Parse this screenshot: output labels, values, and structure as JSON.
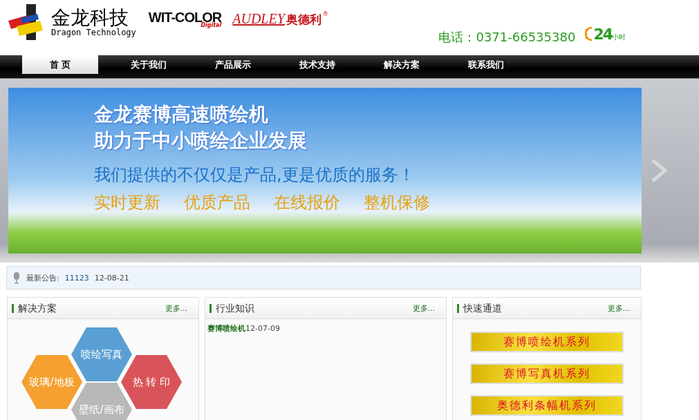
{
  "header": {
    "logo_name": "金龙科技",
    "logo_subtitle": "Dragon Technology",
    "brand_1": "WIT-COLOR",
    "brand_1_sub": "Digital",
    "brand_2": "AUDLEY",
    "brand_2_cn": "奥德利",
    "brand_2_mark": "®",
    "phone": "电话：0371-66535380",
    "hours_number": "24",
    "hours_unit": "小时"
  },
  "nav": [
    {
      "label": "首 页",
      "selected": true
    },
    {
      "label": "关于我们",
      "selected": false
    },
    {
      "label": "产品展示",
      "selected": false
    },
    {
      "label": "技术支持",
      "selected": false
    },
    {
      "label": "解决方案",
      "selected": false
    },
    {
      "label": "联系我们",
      "selected": false
    }
  ],
  "banner": {
    "headline_1": "金龙赛博高速喷绘机",
    "headline_2": "助力于中小喷绘企业发展",
    "tagline": "我们提供的不仅仅是产品,更是优质的服务！",
    "features": [
      "实时更新",
      "优质产品",
      "在线报价",
      "整机保修"
    ]
  },
  "notice": {
    "label": "最新公告:",
    "link": "11123",
    "date": "12-08-21"
  },
  "panels": [
    {
      "title": "解决方案",
      "more": "更多...",
      "kind": "hexagons",
      "hexagons": [
        {
          "label": "喷绘写真",
          "color": "#5a9fd4"
        },
        {
          "label": "玻璃/地板",
          "color": "#f5a030"
        },
        {
          "label": "热 转 印",
          "color": "#d9545a"
        },
        {
          "label": "壁纸/画布",
          "color": "#b8b8b8"
        }
      ]
    },
    {
      "title": "行业知识",
      "more": "更多...",
      "kind": "news",
      "items": [
        {
          "title": "赛博喷绘机",
          "date": "12-07-09"
        }
      ]
    },
    {
      "title": "快速通道",
      "more": "更多...",
      "kind": "links",
      "links": [
        "赛博喷绘机系列",
        "赛博写真机系列",
        "奥德利条幅机系列"
      ]
    }
  ]
}
